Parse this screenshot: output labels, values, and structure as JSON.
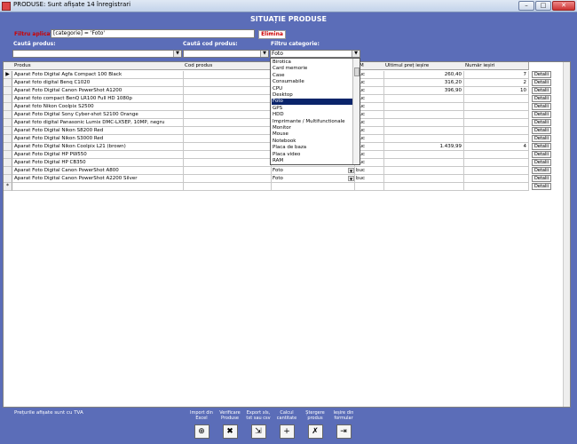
{
  "window": {
    "title": "PRODUSE: Sunt afișate 14 înregistrari",
    "min_label": "–",
    "max_label": "□",
    "close_label": "✕"
  },
  "heading": "SITUAȚIE PRODUSE",
  "filter": {
    "label": "Filtru aplicat:",
    "value": "[categorie] = 'Foto'",
    "remove_label": "Elimina"
  },
  "search": {
    "product_label": "Caută produs:",
    "product_value": "",
    "code_label": "Caută cod produs:",
    "code_value": "",
    "category_label": "Filtru categorie:",
    "category_value": "Foto"
  },
  "columns": {
    "produs": "Produs",
    "cod": "Cod produs",
    "um": "UM",
    "pret": "Ultimul preț ieșire",
    "iesiri": "Număr ieșiri"
  },
  "detail_label": "Detalii",
  "rows": [
    {
      "produs": "Aparat Foto Digital Agfa Compact 100 Black",
      "categorie": "Foto",
      "um": "buc",
      "pret": "260,40",
      "iesiri": "7"
    },
    {
      "produs": "Aparat foto digital Benq C1020",
      "categorie": "Foto",
      "um": "buc",
      "pret": "316,20",
      "iesiri": "2"
    },
    {
      "produs": "Aparat Foto Digital Canon PowerShot A1200",
      "categorie": "Foto",
      "um": "buc",
      "pret": "396,90",
      "iesiri": "10"
    },
    {
      "produs": "Aparat foto compact BenQ LR100 Full HD 1080p",
      "categorie": "Foto",
      "um": "buc",
      "pret": "",
      "iesiri": ""
    },
    {
      "produs": "Aparat foto Nikon Coolpix S2500",
      "categorie": "Foto",
      "um": "buc",
      "pret": "",
      "iesiri": ""
    },
    {
      "produs": "Aparat Foto Digital Sony Cyber-shot S2100 Orange",
      "categorie": "Foto",
      "um": "buc",
      "pret": "",
      "iesiri": ""
    },
    {
      "produs": "Aparat foto digital Panasonic Lumix DMC-LX5EP, 10MP, negru",
      "categorie": "Foto",
      "um": "buc",
      "pret": "",
      "iesiri": ""
    },
    {
      "produs": "Aparat Foto Digital Nikon S8200 Red",
      "categorie": "Foto",
      "um": "buc",
      "pret": "",
      "iesiri": ""
    },
    {
      "produs": "Aparat Foto Digital Nikon S3000 Red",
      "categorie": "Foto",
      "um": "buc",
      "pret": "",
      "iesiri": ""
    },
    {
      "produs": "Aparat Foto Digital Nikon Coolpix L21 (brown)",
      "categorie": "Foto",
      "um": "buc",
      "pret": "1.439,99",
      "iesiri": "4"
    },
    {
      "produs": "Aparat Foto Digital HP PW550",
      "categorie": "Foto",
      "um": "buc",
      "pret": "",
      "iesiri": ""
    },
    {
      "produs": "Aparat Foto Digital HP CB350",
      "categorie": "Foto",
      "um": "buc",
      "pret": "",
      "iesiri": ""
    },
    {
      "produs": "Aparat Foto Digital Canon PowerShot A800",
      "categorie": "Foto",
      "um": "buc",
      "pret": "",
      "iesiri": ""
    },
    {
      "produs": "Aparat Foto Digital Canon PowerShot A2200 Silver",
      "categorie": "Foto",
      "um": "buc",
      "pret": "",
      "iesiri": ""
    }
  ],
  "current_row_marker": "▶",
  "new_row_marker": "*",
  "dropdown_items": [
    "Birotica",
    "Card memorie",
    "Case",
    "Consumabile",
    "CPU",
    "Desktop",
    "Foto",
    "GPS",
    "HDD",
    "Imprimante / Multifunctionale",
    "Monitor",
    "Mouse",
    "Notebook",
    "Placa de baza",
    "Placa video",
    "RAM"
  ],
  "dropdown_selected_index": 6,
  "footer": {
    "note": "Prețurile afișate sunt cu TVA",
    "buttons": [
      {
        "label": "Import din Excel",
        "icon": "excel-import-icon",
        "glyph": "⊕"
      },
      {
        "label": "Verificare Produse",
        "icon": "tools-icon",
        "glyph": "✖"
      },
      {
        "label": "Export xls, txt sau csv",
        "icon": "export-icon",
        "glyph": "⇲"
      },
      {
        "label": "Calcul cantitate",
        "icon": "calculate-icon",
        "glyph": "+"
      },
      {
        "label": "Ștergere produs",
        "icon": "delete-icon",
        "glyph": "✗"
      },
      {
        "label": "Ieșire din formular",
        "icon": "exit-icon",
        "glyph": "⇥"
      }
    ]
  }
}
